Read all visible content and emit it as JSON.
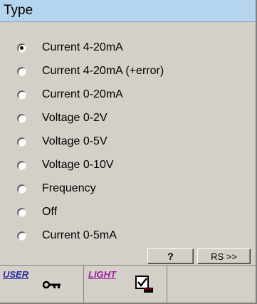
{
  "header": {
    "title": "Type"
  },
  "options": [
    {
      "label": "Current 4-20mA",
      "selected": true
    },
    {
      "label": "Current 4-20mA (+error)",
      "selected": false
    },
    {
      "label": "Current 0-20mA",
      "selected": false
    },
    {
      "label": "Voltage 0-2V",
      "selected": false
    },
    {
      "label": "Voltage 0-5V",
      "selected": false
    },
    {
      "label": "Voltage 0-10V",
      "selected": false
    },
    {
      "label": "Frequency",
      "selected": false
    },
    {
      "label": "Off",
      "selected": false
    },
    {
      "label": "Current 0-5mA",
      "selected": false
    }
  ],
  "buttons": {
    "help": "?",
    "rs": "RS >>"
  },
  "status": {
    "user_label": "USER",
    "light_label": "LIGHT",
    "key_icon": "key-icon",
    "checkbox_icon": "checkbox-checked-icon"
  },
  "colors": {
    "titlebar": "#b5d5ee",
    "panel": "#d4d0c8",
    "user_text": "#2a2aa0",
    "light_text": "#a020a0"
  }
}
